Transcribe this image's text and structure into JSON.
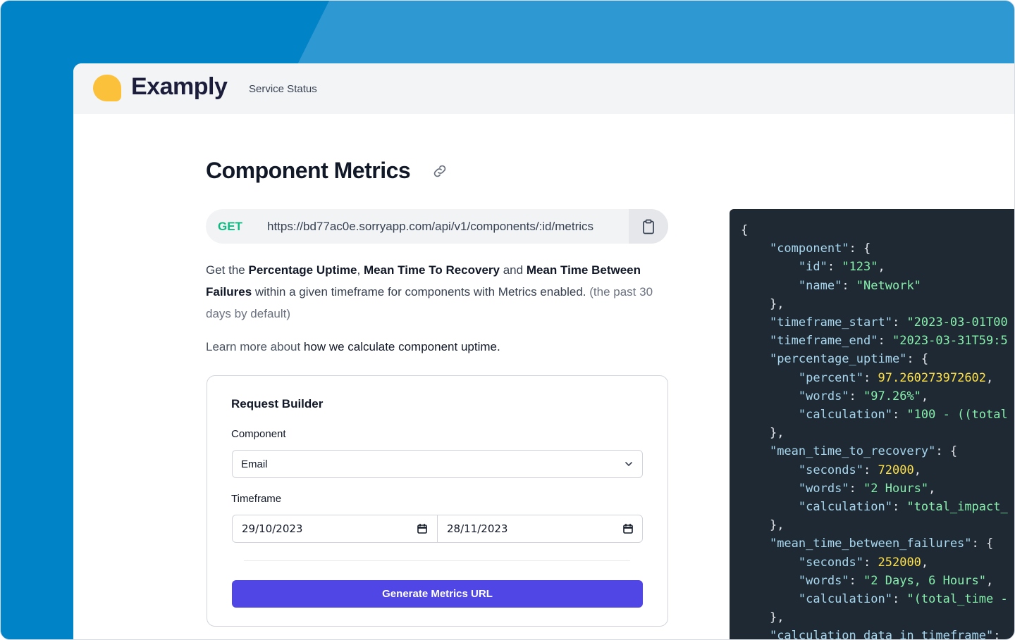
{
  "colors": {
    "background_light": "#2e98d3",
    "background_dark": "#0083c7",
    "logo": "#fbc13b",
    "primary_button": "#4f46e5",
    "method_get": "#10b981",
    "code_bg": "#1f2933"
  },
  "header": {
    "brand": "Examply",
    "nav_link": "Service Status"
  },
  "page": {
    "title": "Component Metrics",
    "link_icon": "link-icon"
  },
  "endpoint": {
    "method": "GET",
    "url": "https://bd77ac0e.sorryapp.com/api/v1/components/:id/metrics",
    "copy_icon": "clipboard-icon"
  },
  "description": {
    "p1": "Get the ",
    "b1": "Percentage Uptime",
    "p2": ", ",
    "b2": "Mean Time To Recovery",
    "p3": " and ",
    "b3": "Mean Time Between Failures",
    "p4": " within a given timeframe for components with Metrics enabled.",
    "muted": " (the past 30 days by default)",
    "learn_prefix": "Learn more about ",
    "learn_link": "how we calculate component uptime."
  },
  "builder": {
    "title": "Request Builder",
    "component_label": "Component",
    "component_value": "Email",
    "timeframe_label": "Timeframe",
    "start_date": "29/10/2023",
    "end_date": "28/11/2023",
    "generate_label": "Generate Metrics URL"
  },
  "code_sample": {
    "l01": "{",
    "l02_key": "\"component\"",
    "l02_rest": ": {",
    "l03_key": "\"id\"",
    "l03_val": "\"123\"",
    "l04_key": "\"name\"",
    "l04_val": "\"Network\"",
    "l05": "},",
    "l06_key": "\"timeframe_start\"",
    "l06_val": "\"2023-03-01T00",
    "l07_key": "\"timeframe_end\"",
    "l07_val": "\"2023-03-31T59:5",
    "l08_key": "\"percentage_uptime\"",
    "l08_rest": ": {",
    "l09_key": "\"percent\"",
    "l09_val": "97.260273972602",
    "l10_key": "\"words\"",
    "l10_val": "\"97.26%\"",
    "l11_key": "\"calculation\"",
    "l11_val": "\"100 - ((total",
    "l12": "},",
    "l13_key": "\"mean_time_to_recovery\"",
    "l13_rest": ": {",
    "l14_key": "\"seconds\"",
    "l14_val": "72000",
    "l15_key": "\"words\"",
    "l15_val": "\"2 Hours\"",
    "l16_key": "\"calculation\"",
    "l16_val": "\"total_impact_",
    "l17": "},",
    "l18_key": "\"mean_time_between_failures\"",
    "l18_rest": ": {",
    "l19_key": "\"seconds\"",
    "l19_val": "252000",
    "l20_key": "\"words\"",
    "l20_val": "\"2 Days, 6 Hours\"",
    "l21_key": "\"calculation\"",
    "l21_val": "\"(total_time -",
    "l22": "},",
    "l23_key": "\"calculation_data_in_timeframe\"",
    "l23_rest": ":"
  }
}
